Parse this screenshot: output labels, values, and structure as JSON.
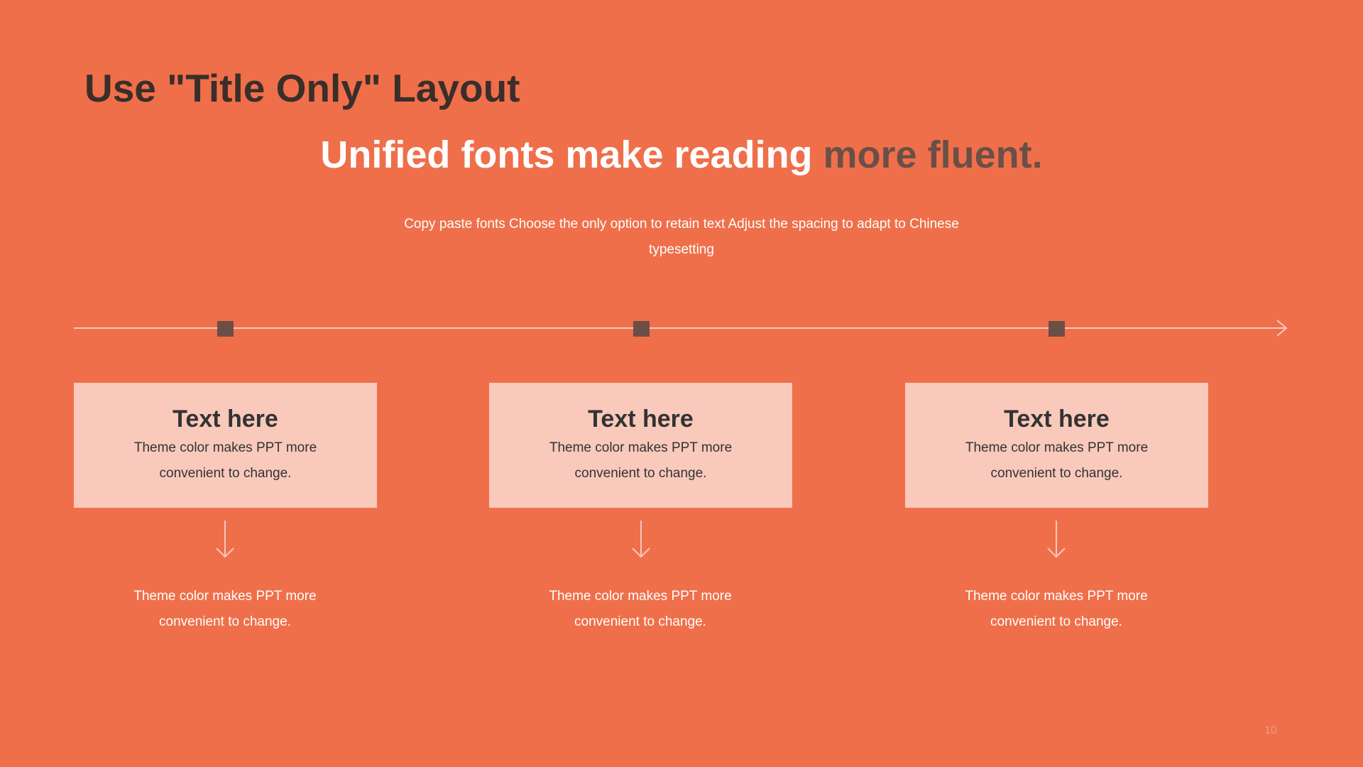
{
  "slide": {
    "title": "Use \"Title Only\" Layout",
    "headline": {
      "main": "Unified fonts make reading ",
      "accent": "more fluent."
    },
    "subtitle": "Copy paste fonts Choose the only option to retain text Adjust the spacing to adapt to Chinese  typesetting",
    "cards": [
      {
        "title": "Text here",
        "text": "Theme  color makes PPT more convenient  to change."
      },
      {
        "title": "Text here",
        "text": "Theme  color makes PPT more convenient  to change."
      },
      {
        "title": "Text here",
        "text": "Theme  color makes PPT more convenient  to change."
      }
    ],
    "below_texts": [
      "Theme  color makes PPT more convenient  to change.",
      "Theme  color makes PPT more convenient  to change.",
      "Theme  color makes PPT more convenient  to change."
    ],
    "page_number": "10"
  },
  "colors": {
    "background": "#EF6F4A",
    "title": "#3A2E2A",
    "accent": "#6B4F47",
    "card": "#F9C9BB",
    "line": "#F9C9BB",
    "marker": "#6B4F47"
  }
}
